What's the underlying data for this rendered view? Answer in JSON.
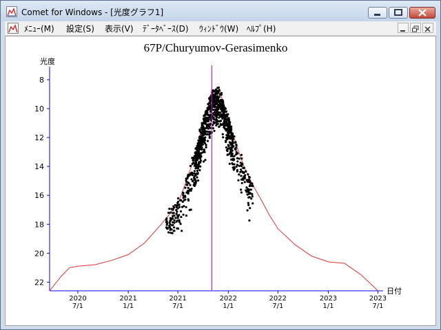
{
  "window": {
    "title": "Comet for Windows - [光度グラフ1]",
    "icons": {
      "app": "graph-icon",
      "minimize": "minimize-icon",
      "maximize": "maximize-icon",
      "close": "close-icon"
    }
  },
  "menu": {
    "items": [
      {
        "label": "ﾒﾆｭｰ(M)"
      },
      {
        "label": "設定(S)"
      },
      {
        "label": "表示(V)"
      },
      {
        "label": "ﾃﾞｰﾀﾍﾞｰｽ(D)"
      },
      {
        "label": "ｳｨﾝﾄﾞｳ(W)"
      },
      {
        "label": "ﾍﾙﾌﾟ(H)"
      }
    ],
    "mdi_icons": [
      "mdi-minimize-icon",
      "mdi-restore-icon",
      "mdi-close-icon"
    ]
  },
  "chart_data": {
    "type": "scatter",
    "title": "67P/Churyumov-Gerasimenko",
    "ylabel": "光度",
    "xlabel": "日付",
    "ylim": [
      22.6,
      7.1
    ],
    "y_reversed": true,
    "yticks": [
      8,
      10,
      12,
      14,
      16,
      18,
      20,
      22
    ],
    "xlim": [
      "2020-03-20",
      "2023-07-20"
    ],
    "xticks": [
      {
        "date": "2020-07-01",
        "year": "2020",
        "md": "7/1"
      },
      {
        "date": "2021-01-01",
        "year": "2021",
        "md": "1/1"
      },
      {
        "date": "2021-07-01",
        "year": "2021",
        "md": "7/1"
      },
      {
        "date": "2022-01-01",
        "year": "2022",
        "md": "1/1"
      },
      {
        "date": "2022-07-01",
        "year": "2022",
        "md": "7/1"
      },
      {
        "date": "2023-01-01",
        "year": "2023",
        "md": "1/1"
      },
      {
        "date": "2023-07-01",
        "year": "2023",
        "md": "7/1"
      }
    ],
    "perihelion_date": "2021-11-02",
    "colors": {
      "axis": "#0000ff",
      "curve": "#e03030",
      "marker": "#cc00cc",
      "points": "#000000",
      "labels": "#000000"
    },
    "curve": [
      [
        "2020-03-20",
        22.6
      ],
      [
        "2020-05-01",
        21.6
      ],
      [
        "2020-06-01",
        21.0
      ],
      [
        "2020-07-01",
        20.9
      ],
      [
        "2020-09-01",
        20.8
      ],
      [
        "2020-11-01",
        20.5
      ],
      [
        "2021-01-01",
        20.1
      ],
      [
        "2021-03-01",
        19.3
      ],
      [
        "2021-05-01",
        18.0
      ],
      [
        "2021-07-01",
        16.6
      ],
      [
        "2021-08-01",
        15.0
      ],
      [
        "2021-09-01",
        13.3
      ],
      [
        "2021-10-01",
        11.0
      ],
      [
        "2021-11-01",
        9.1
      ],
      [
        "2021-11-15",
        8.9
      ],
      [
        "2021-12-01",
        8.9
      ],
      [
        "2021-12-15",
        9.6
      ],
      [
        "2022-01-01",
        10.8
      ],
      [
        "2022-02-01",
        12.6
      ],
      [
        "2022-03-01",
        14.1
      ],
      [
        "2022-04-01",
        15.3
      ],
      [
        "2022-05-01",
        16.3
      ],
      [
        "2022-06-01",
        17.4
      ],
      [
        "2022-07-01",
        18.3
      ],
      [
        "2022-09-01",
        19.4
      ],
      [
        "2022-11-01",
        20.2
      ],
      [
        "2023-01-01",
        20.6
      ],
      [
        "2023-03-01",
        20.7
      ],
      [
        "2023-05-01",
        21.5
      ],
      [
        "2023-06-15",
        22.3
      ],
      [
        "2023-07-01",
        22.6
      ]
    ],
    "observations_note_count": 1000
  }
}
